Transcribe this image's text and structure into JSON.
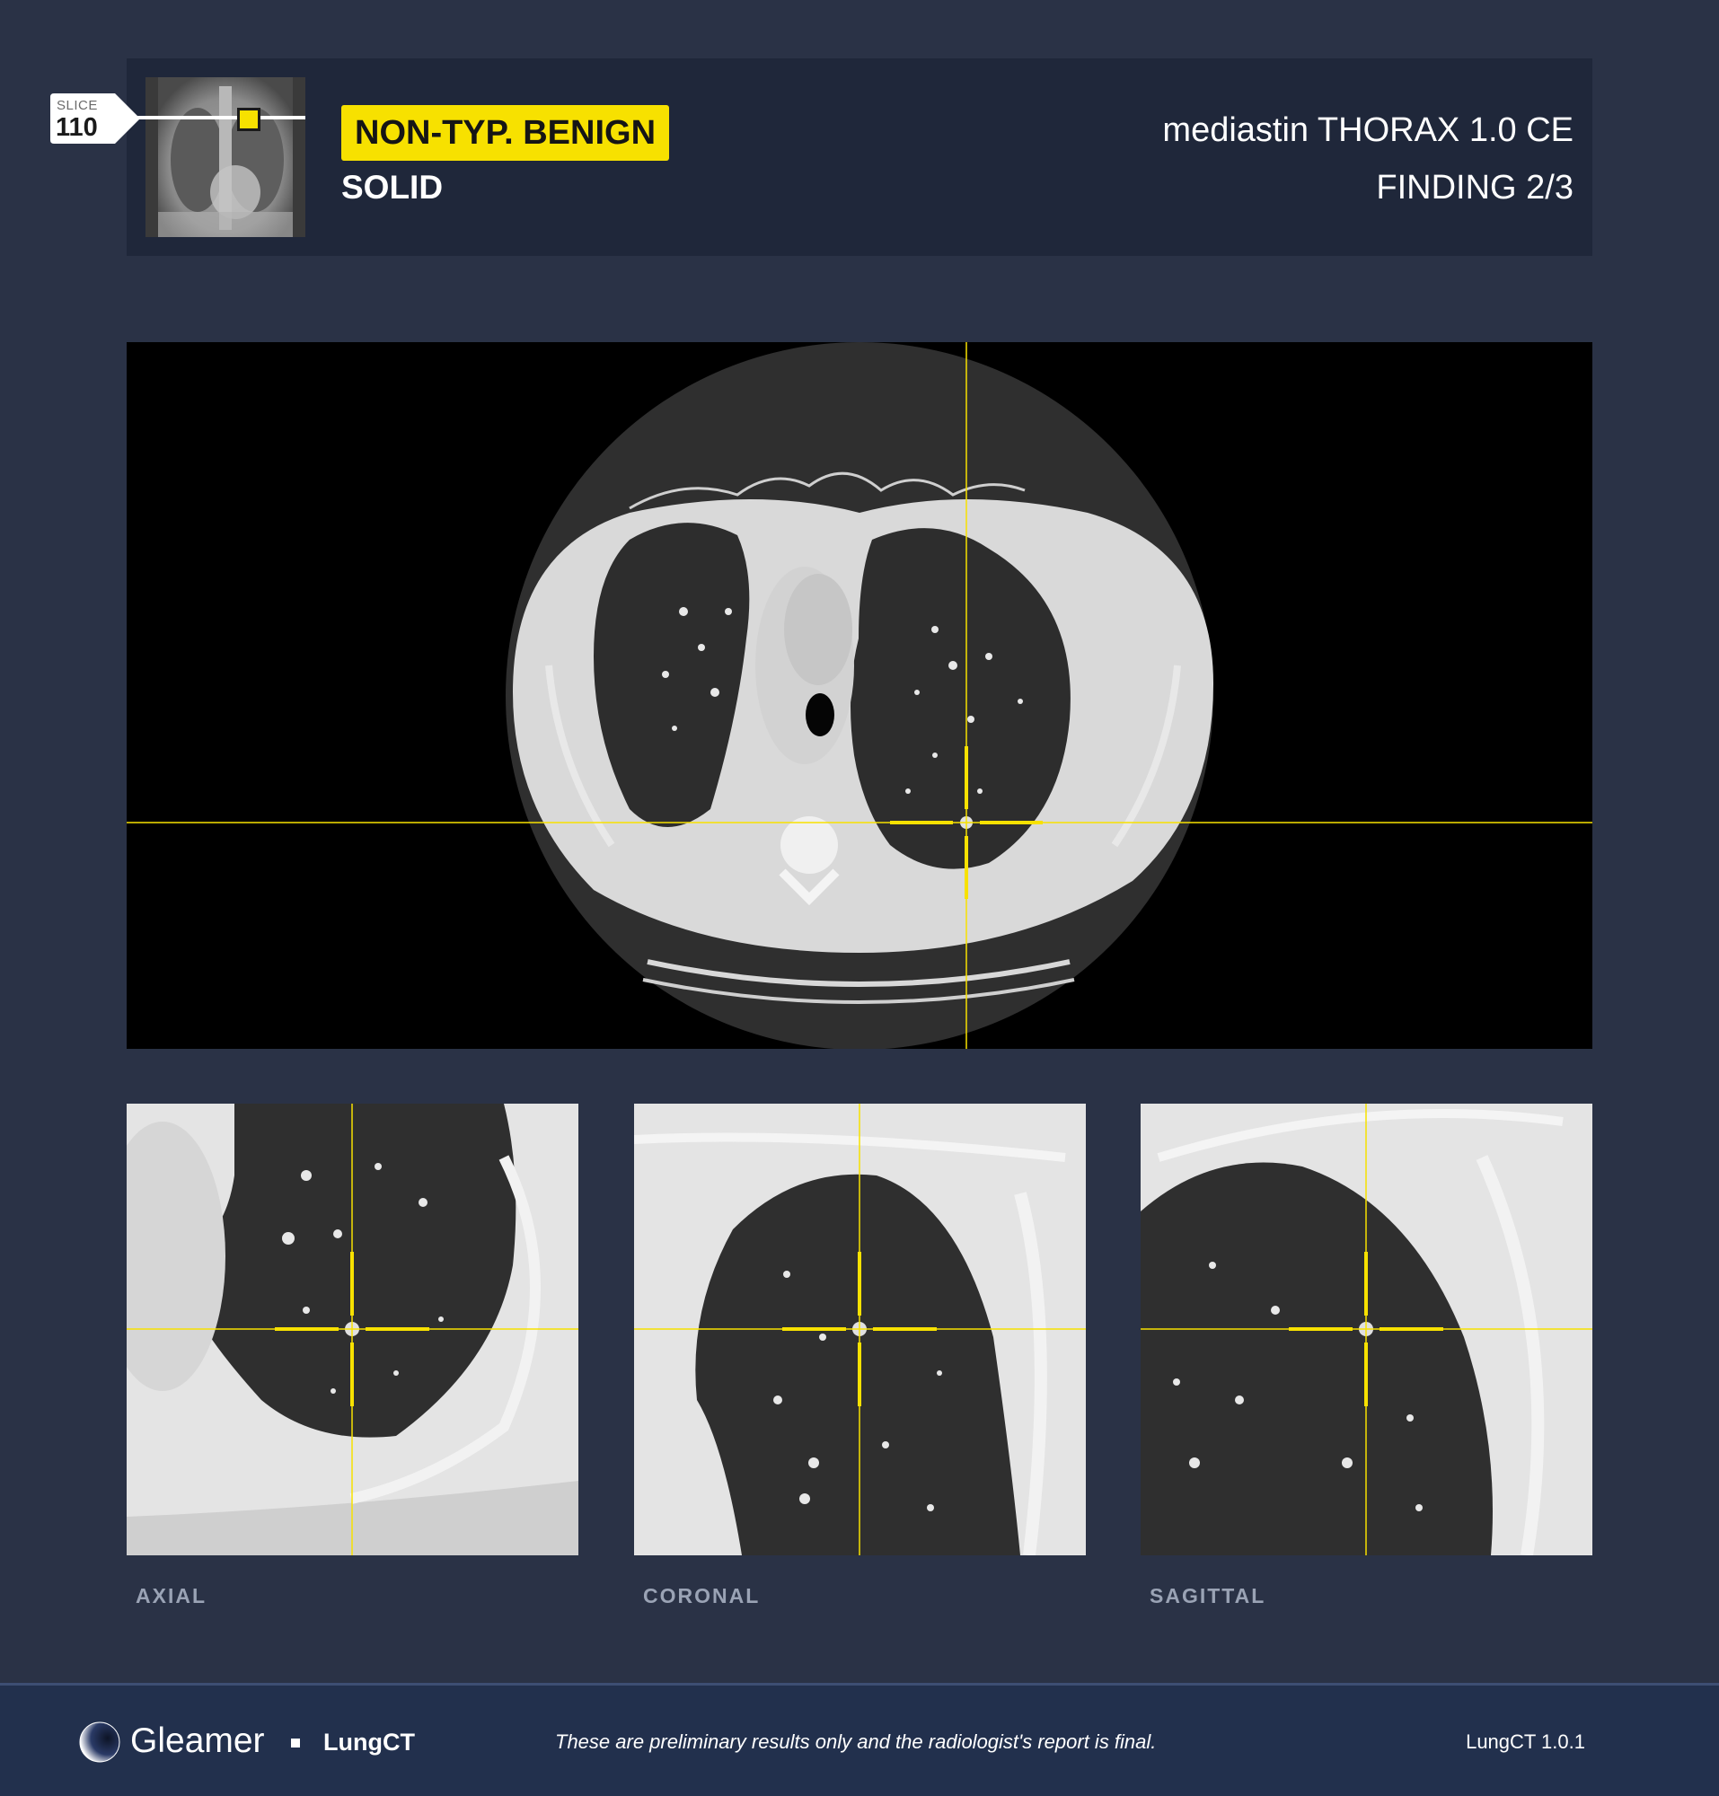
{
  "header": {
    "slice_label": "SLICE",
    "slice_number": "110",
    "classification": "NON-TYP. BENIGN",
    "nodule_type": "SOLID",
    "series_description": "mediastin THORAX 1.0 CE",
    "finding_index": "FINDING 2/3"
  },
  "views": [
    {
      "label": "AXIAL"
    },
    {
      "label": "CORONAL"
    },
    {
      "label": "SAGITTAL"
    }
  ],
  "footer": {
    "brand": "Gleamer",
    "product": "LungCT",
    "disclaimer": "These are preliminary results only and the radiologist's report is final.",
    "version": "LungCT 1.0.1"
  },
  "colors": {
    "accent": "#f7e100",
    "background": "#2a3246",
    "header_card": "#1f273a",
    "footer": "#22304d"
  },
  "icons": [
    "gleamer-logo-icon",
    "slice-tag-icon",
    "crosshair-icon"
  ]
}
